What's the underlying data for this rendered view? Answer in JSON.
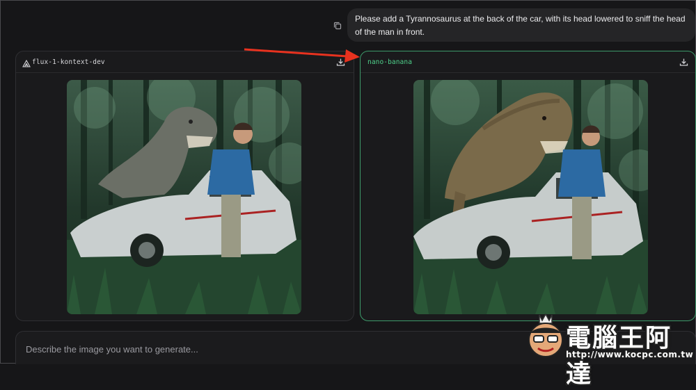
{
  "prompt": {
    "text": "Please add a Tyrannosaurus at the back of the car, with its head lowered to sniff the head of the man in front.",
    "copy_icon": "copy-icon"
  },
  "panels": [
    {
      "model": "flux-1-kontext-dev",
      "icon": "flux-logo-icon",
      "image_alt": "Generated image: grey cartoon dinosaur behind an abandoned white car, man in blue shirt standing in forest",
      "download_icon": "download-icon"
    },
    {
      "model": "nano-banana",
      "image_alt": "Generated image: realistic Tyrannosaurus behind an abandoned white car, man in blue shirt standing in forest",
      "download_icon": "download-icon",
      "selected": true
    }
  ],
  "input": {
    "placeholder": "Describe the image you want to generate..."
  },
  "watermark": {
    "logo_text": "電腦王阿達",
    "url": "http://www.kocpc.com.tw"
  },
  "colors": {
    "accent_green": "#4fd08a",
    "annotation_arrow": "#e8321f"
  }
}
